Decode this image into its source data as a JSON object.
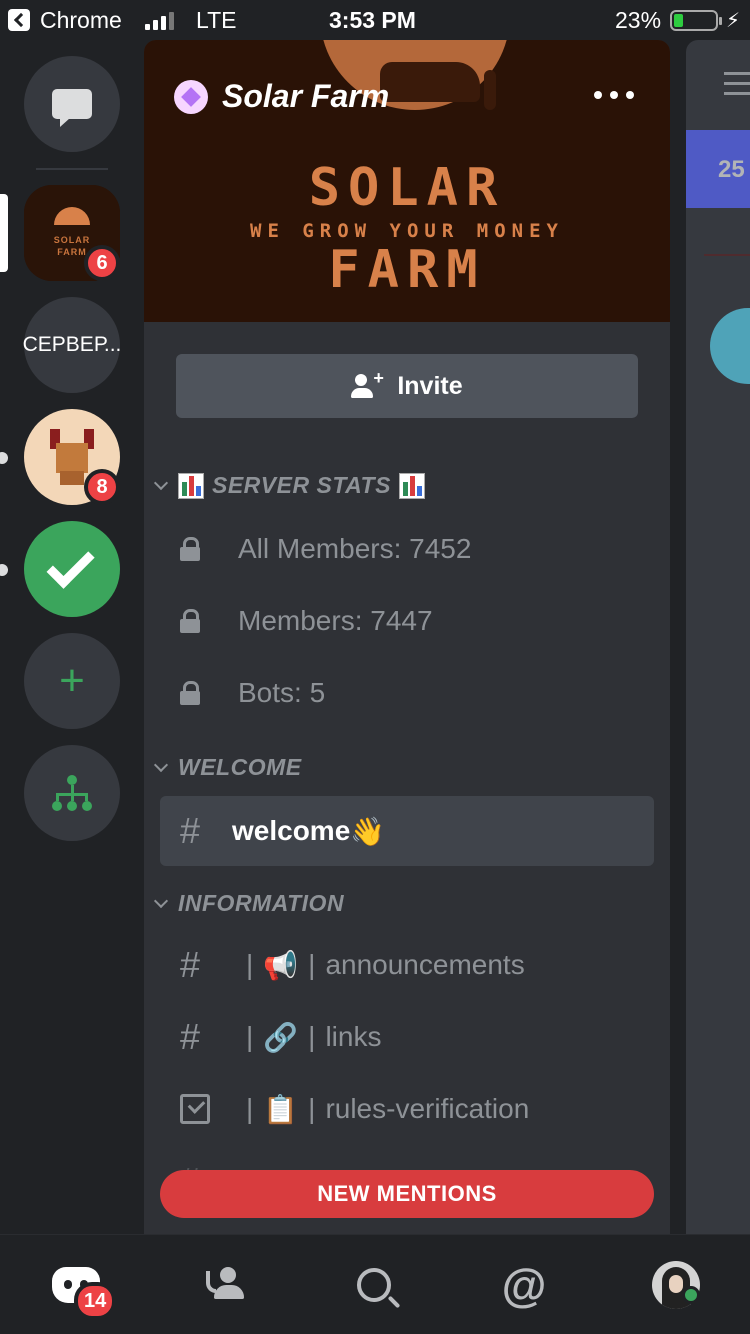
{
  "status_bar": {
    "back_app": "Chrome",
    "network": "LTE",
    "time": "3:53 PM",
    "battery_text": "23%",
    "battery_level": 0.23
  },
  "rail": {
    "badges": {
      "solar": "6",
      "avatar": "8"
    },
    "ru_server_label": "СЕРВЕР..."
  },
  "server": {
    "name": "Solar Farm",
    "banner": {
      "line1": "SOLAR",
      "line2": "WE GROW YOUR MONEY",
      "line3": "FARM"
    },
    "mini_line1": "SOLAR",
    "mini_line2": "FARM"
  },
  "invite_label": "Invite",
  "categories": {
    "server_stats": "SERVER STATS",
    "welcome": "WELCOME",
    "information": "INFORMATION"
  },
  "channels": {
    "all_members": "All Members: 7452",
    "members": "Members: 7447",
    "bots": "Bots: 5",
    "welcome": "welcome",
    "welcome_emoji": "👋",
    "announcements": "announcements",
    "announcements_emoji": "📢",
    "links": "links",
    "links_emoji": "🔗",
    "rules": "rules-verification",
    "rules_emoji": "📋",
    "sep": "|"
  },
  "new_mentions": "NEW MENTIONS",
  "peek": {
    "count": "25"
  },
  "bottom_nav": {
    "home_badge": "14",
    "mention_symbol": "@"
  },
  "colors": {
    "rail_bg": "#202225",
    "panel_bg": "#2f3136",
    "accent_green": "#3ba55c",
    "badge_red": "#ed4245",
    "blurple": "#5865f2"
  }
}
